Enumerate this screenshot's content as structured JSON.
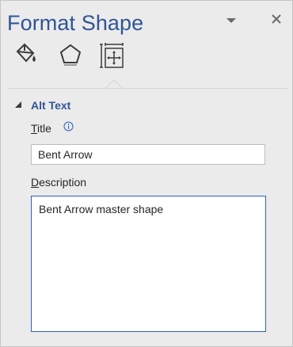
{
  "pane": {
    "title": "Format Shape",
    "menu_icon": "dropdown-triangle-icon",
    "close_icon": "close-icon",
    "tabs": [
      {
        "icon": "fill-line-icon",
        "selected": false
      },
      {
        "icon": "effects-pentagon-icon",
        "selected": false
      },
      {
        "icon": "size-properties-icon",
        "selected": true
      }
    ]
  },
  "alt_text": {
    "section_title": "Alt Text",
    "title_label_accel": "T",
    "title_label_rest": "itle",
    "title_value": "Bent Arrow",
    "info_icon": "info-icon",
    "description_label_accel": "D",
    "description_label_rest": "escription",
    "description_value": "Bent Arrow master shape"
  },
  "colors": {
    "accent": "#2f5597",
    "pane_bg": "#ebebeb",
    "focus_border": "#2f5fbf"
  }
}
